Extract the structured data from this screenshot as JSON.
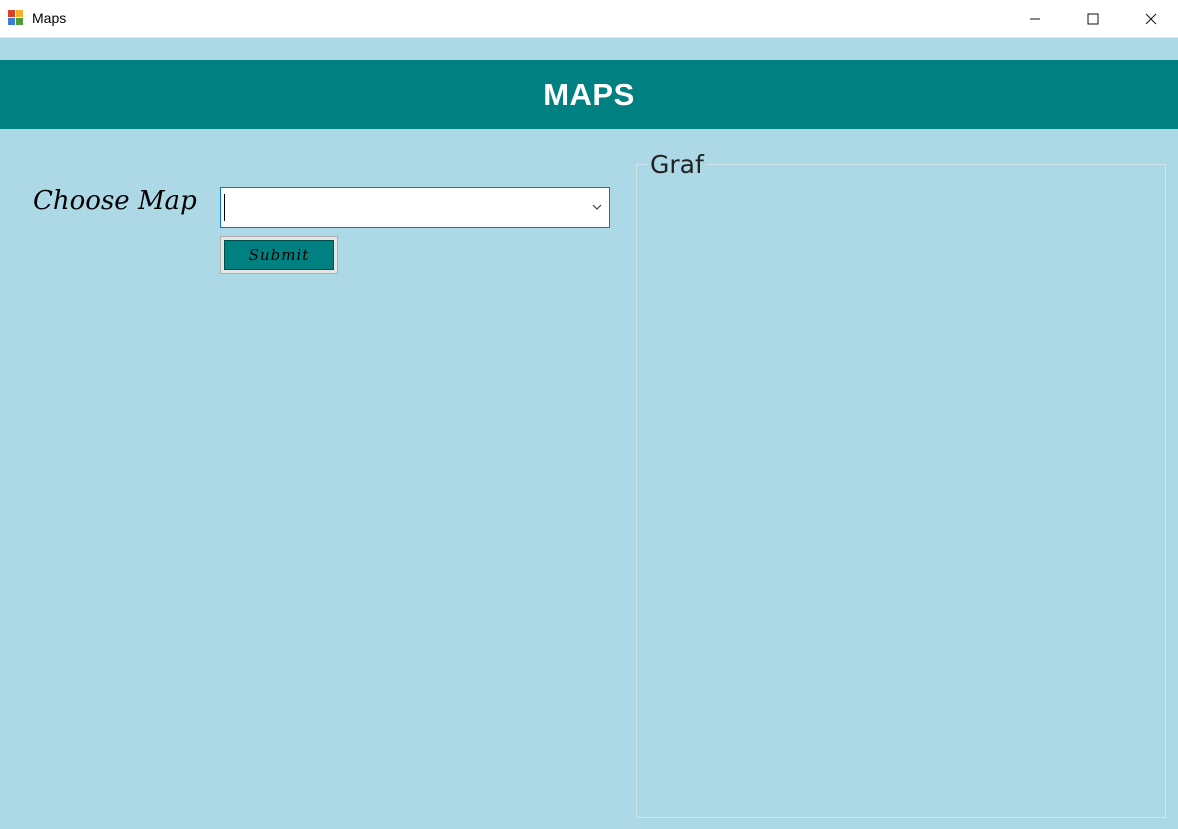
{
  "window": {
    "title": "Maps",
    "controls": {
      "minimize": "minimize",
      "maximize": "maximize",
      "close": "close"
    }
  },
  "header": {
    "title": "MAPS"
  },
  "form": {
    "choose_label": "Choose Map",
    "map_select_value": "",
    "submit_label": "Submit"
  },
  "graph_panel": {
    "title": "Graf"
  },
  "colors": {
    "background": "#add8e6",
    "header_band": "#008080",
    "button": "#008080",
    "focus_border": "#0078d7"
  }
}
